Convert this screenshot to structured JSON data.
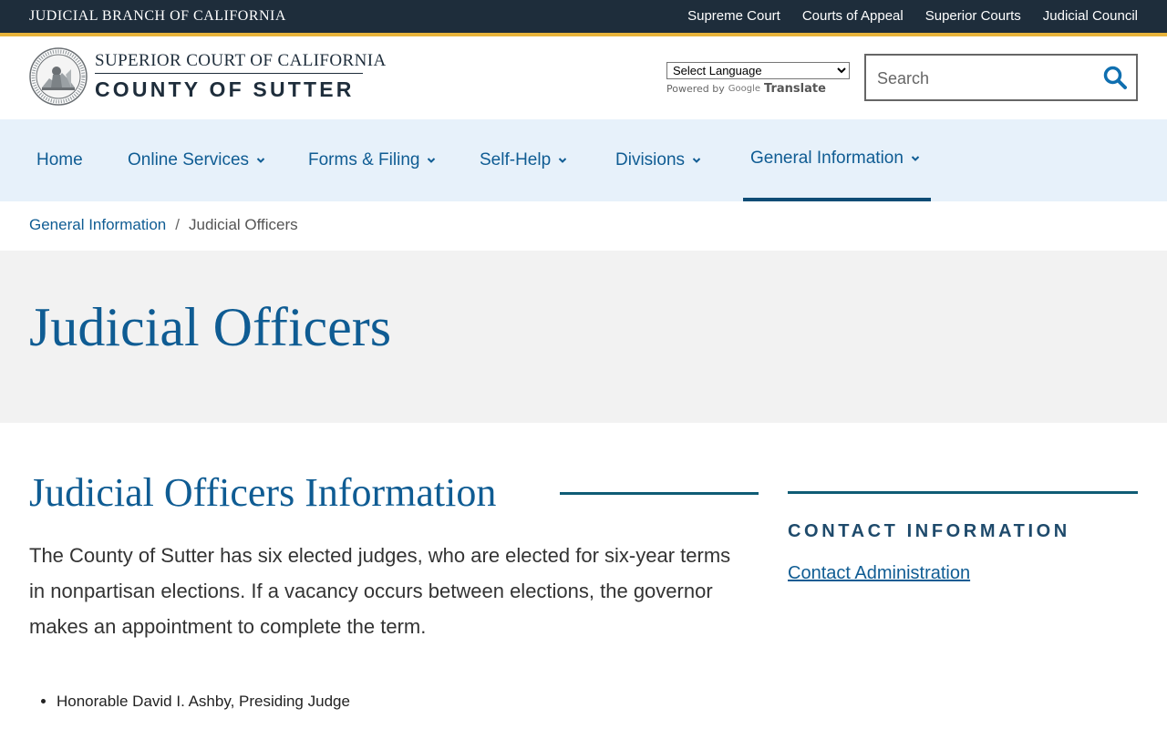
{
  "topbar": {
    "branch_title": "JUDICIAL BRANCH OF CALIFORNIA",
    "links": [
      "Supreme Court",
      "Courts of Appeal",
      "Superior Courts",
      "Judicial Council"
    ]
  },
  "header": {
    "court_line1": "SUPERIOR COURT OF CALIFORNIA",
    "court_line2": "COUNTY OF SUTTER",
    "seal_icon": "state-seal-icon",
    "language_select": "Select Language",
    "powered_by": "Powered by",
    "google": "Google",
    "translate": "Translate",
    "search_placeholder": "Search"
  },
  "nav": {
    "items": [
      {
        "label": "Home",
        "dropdown": false
      },
      {
        "label": "Online Services",
        "dropdown": true
      },
      {
        "label": "Forms & Filing",
        "dropdown": true
      },
      {
        "label": "Self-Help",
        "dropdown": true
      },
      {
        "label": "Divisions",
        "dropdown": true
      },
      {
        "label": "General Information",
        "dropdown": true,
        "active": true
      }
    ]
  },
  "breadcrumb": {
    "parent": "General Information",
    "separator": "/",
    "current": "Judicial Officers"
  },
  "hero": {
    "title": "Judicial Officers"
  },
  "main": {
    "section_title": "Judicial Officers Information",
    "intro": "The County of Sutter has six elected judges, who are elected for six-year terms in nonpartisan elections. If a vacancy occurs between elections, the governor makes an appointment to complete the term.",
    "judges": [
      "Honorable David I. Ashby, Presiding Judge"
    ]
  },
  "sidebar": {
    "title": "CONTACT INFORMATION",
    "link": "Contact Administration"
  },
  "colors": {
    "topbar": "#1e2d3b",
    "gold": "#e8b33a",
    "brand_blue": "#0f5c93",
    "nav_bg": "#e7f1fa",
    "hero_bg": "#f2f2f2"
  }
}
